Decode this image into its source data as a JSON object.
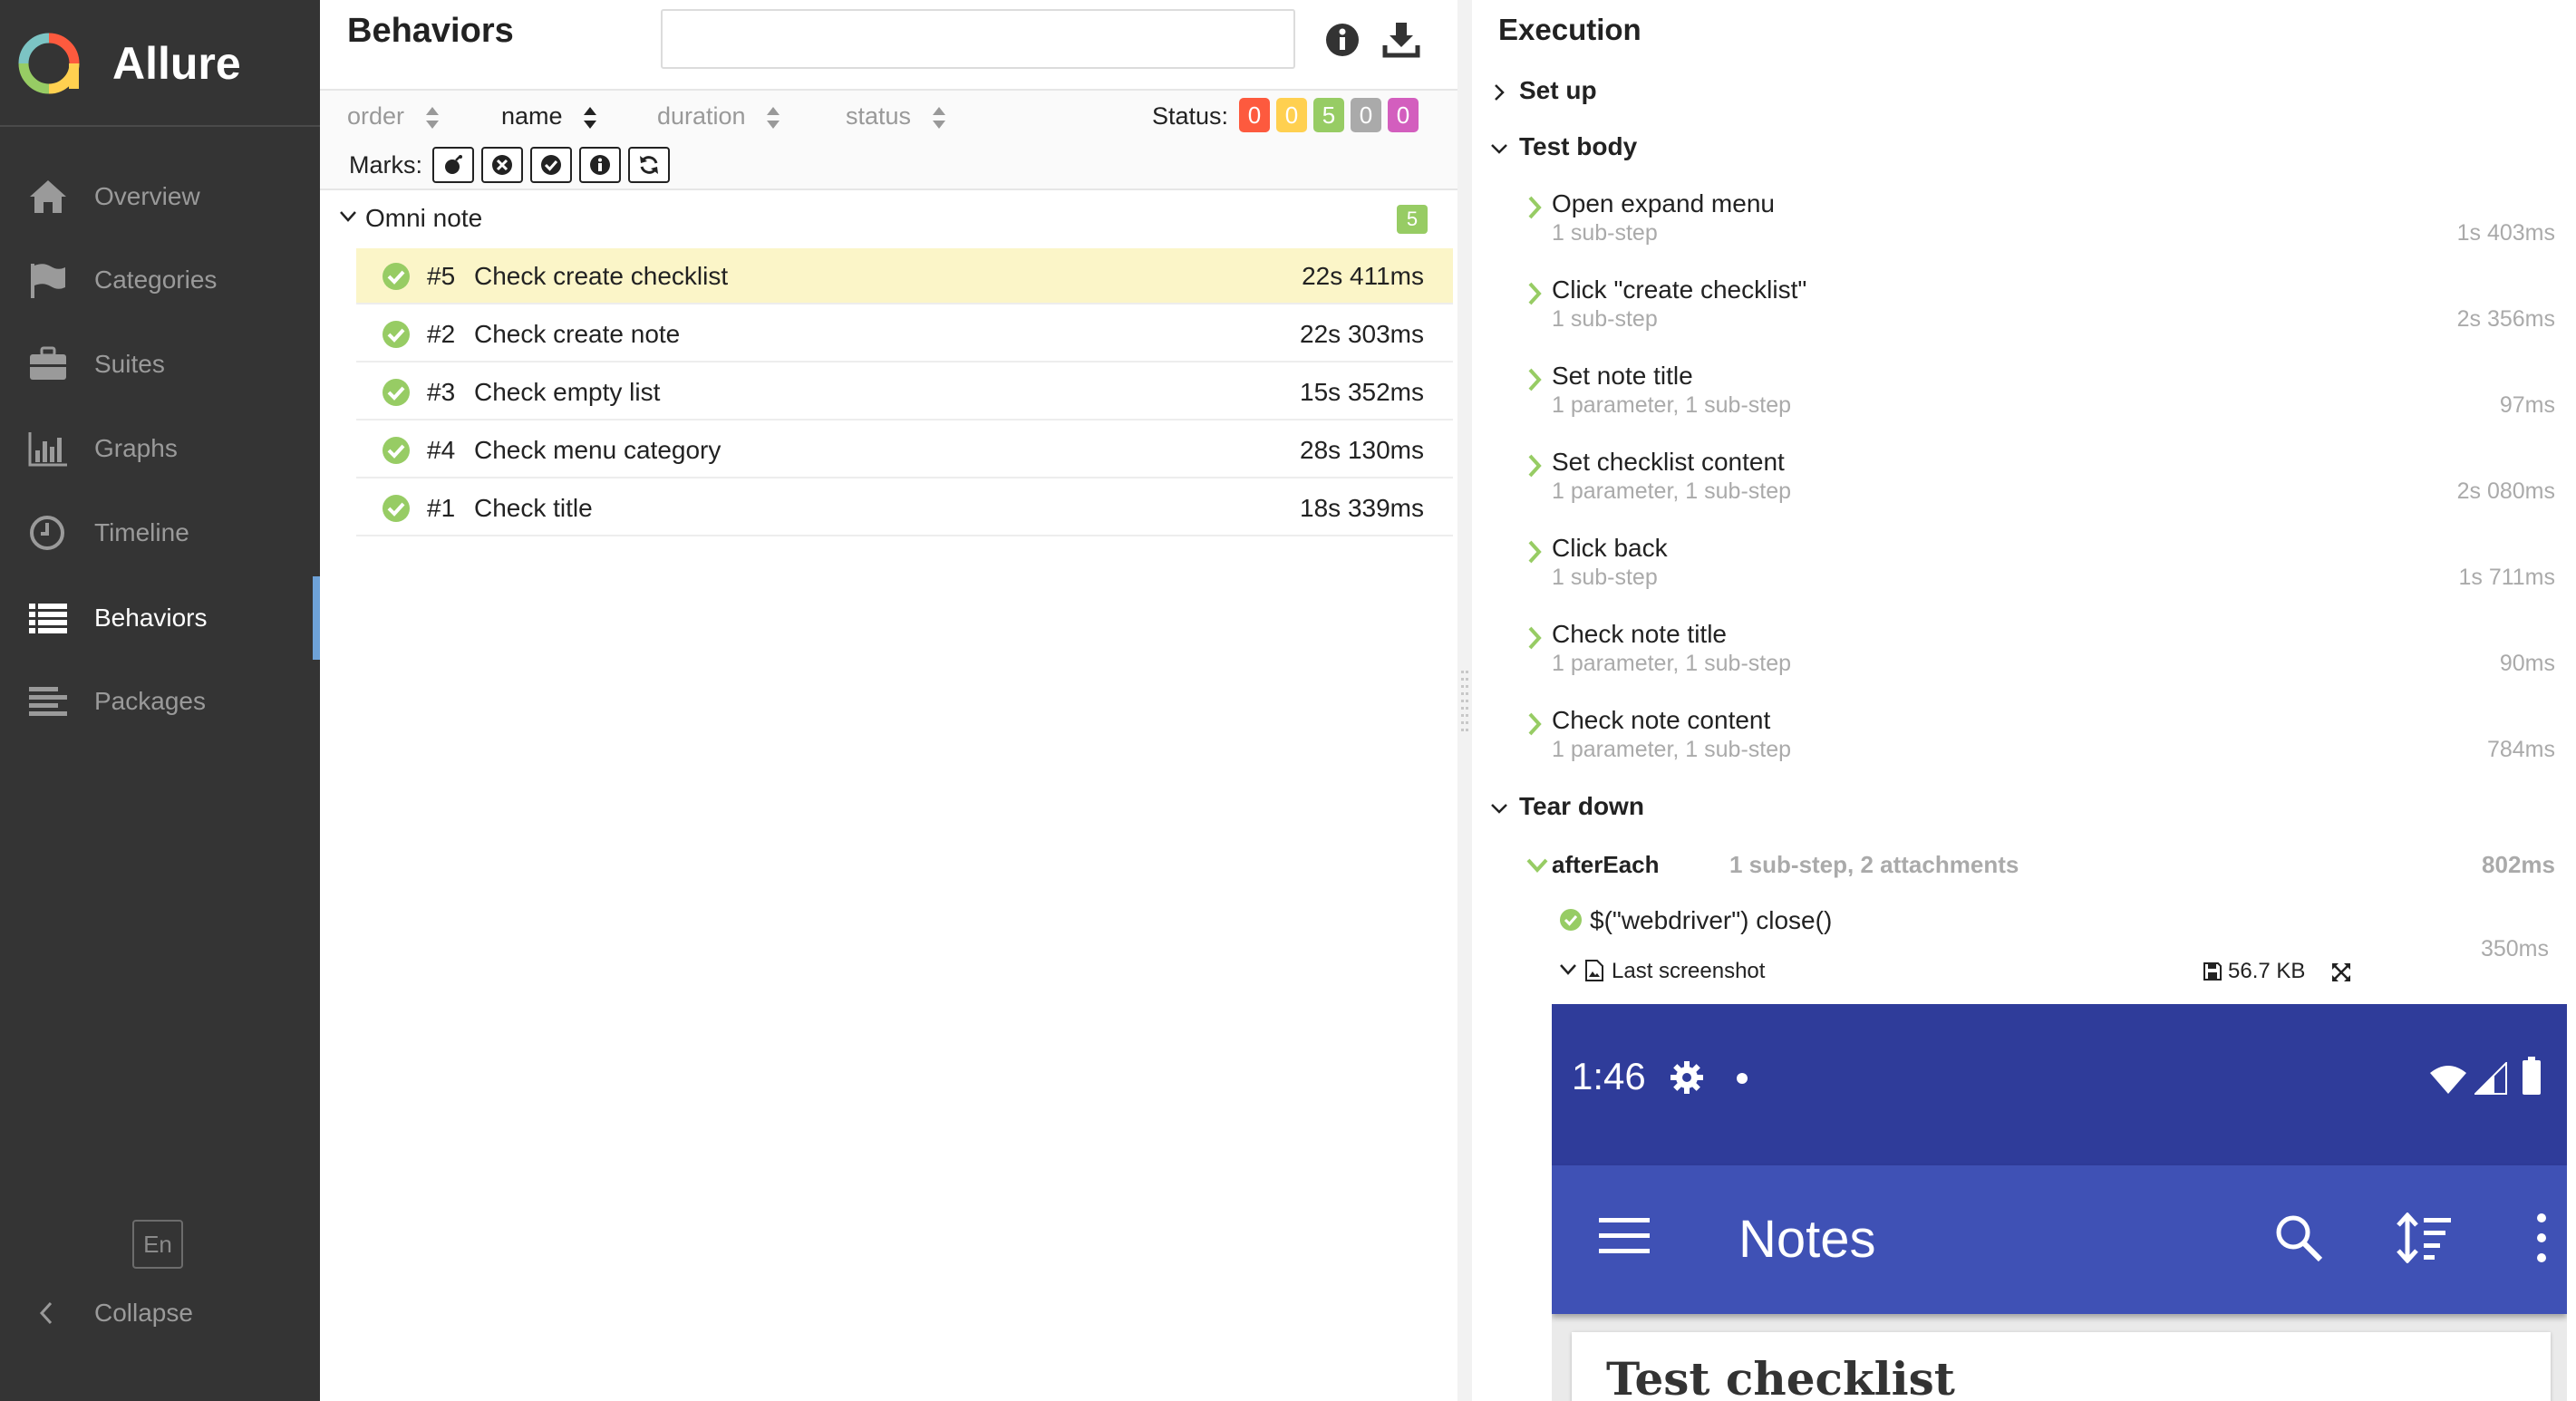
{
  "sidebar": {
    "brand": "Allure",
    "items": [
      {
        "label": "Overview",
        "icon": "home-icon"
      },
      {
        "label": "Categories",
        "icon": "flag-icon"
      },
      {
        "label": "Suites",
        "icon": "briefcase-icon"
      },
      {
        "label": "Graphs",
        "icon": "bar-chart-icon"
      },
      {
        "label": "Timeline",
        "icon": "clock-icon"
      },
      {
        "label": "Behaviors",
        "icon": "list-icon",
        "active": true
      },
      {
        "label": "Packages",
        "icon": "align-left-icon"
      }
    ],
    "language": "En",
    "collapse_label": "Collapse"
  },
  "behaviors": {
    "title": "Behaviors",
    "search": {
      "value": "",
      "placeholder": ""
    },
    "sort": {
      "order": "order",
      "name": "name",
      "duration": "duration",
      "status": "status",
      "active": "name"
    },
    "status_label": "Status:",
    "status_counts": [
      {
        "status": "failed",
        "count": "0",
        "color": "#fd5a3e"
      },
      {
        "status": "broken",
        "count": "0",
        "color": "#ffd050"
      },
      {
        "status": "passed",
        "count": "5",
        "color": "#97cc64"
      },
      {
        "status": "skipped",
        "count": "0",
        "color": "#aaaaaa"
      },
      {
        "status": "unknown",
        "count": "0",
        "color": "#d35ebe"
      }
    ],
    "marks_label": "Marks:",
    "marks": [
      "flaky-icon",
      "new-failed-icon",
      "new-passed-icon",
      "new-broken-icon",
      "retries-icon"
    ],
    "group": {
      "name": "Omni note",
      "count": "5"
    },
    "tests": [
      {
        "num": "#5",
        "name": "Check create checklist",
        "duration": "22s 411ms",
        "selected": true
      },
      {
        "num": "#2",
        "name": "Check create note",
        "duration": "22s 303ms"
      },
      {
        "num": "#3",
        "name": "Check empty list",
        "duration": "15s 352ms"
      },
      {
        "num": "#4",
        "name": "Check menu category",
        "duration": "28s 130ms"
      },
      {
        "num": "#1",
        "name": "Check title",
        "duration": "18s 339ms"
      }
    ]
  },
  "execution": {
    "title": "Execution",
    "setup_label": "Set up",
    "body_label": "Test body",
    "teardown_label": "Tear down",
    "steps": [
      {
        "name": "Open expand menu",
        "meta": "1 sub-step",
        "duration": "1s 403ms"
      },
      {
        "name": "Click \"create checklist\"",
        "meta": "1 sub-step",
        "duration": "2s 356ms"
      },
      {
        "name": "Set note title",
        "meta": "1 parameter, 1 sub-step",
        "duration": "97ms"
      },
      {
        "name": "Set checklist content",
        "meta": "1 parameter, 1 sub-step",
        "duration": "2s 080ms"
      },
      {
        "name": "Click back",
        "meta": "1 sub-step",
        "duration": "1s 711ms"
      },
      {
        "name": "Check note title",
        "meta": "1 parameter, 1 sub-step",
        "duration": "90ms"
      },
      {
        "name": "Check note content",
        "meta": "1 parameter, 1 sub-step",
        "duration": "784ms"
      }
    ],
    "after_each": {
      "name": "afterEach",
      "meta": "1 sub-step, 2 attachments",
      "duration": "802ms"
    },
    "sub_step": {
      "name": "$(\"webdriver\") close()",
      "duration": "350ms"
    },
    "attachment": {
      "name": "Last screenshot",
      "size": "56.7 KB"
    }
  },
  "phone": {
    "time": "1:46",
    "app_title": "Notes",
    "card_title": "Test checklist",
    "status_bar_color": "#2f3c9a",
    "app_bar_color": "#3f51b5"
  }
}
